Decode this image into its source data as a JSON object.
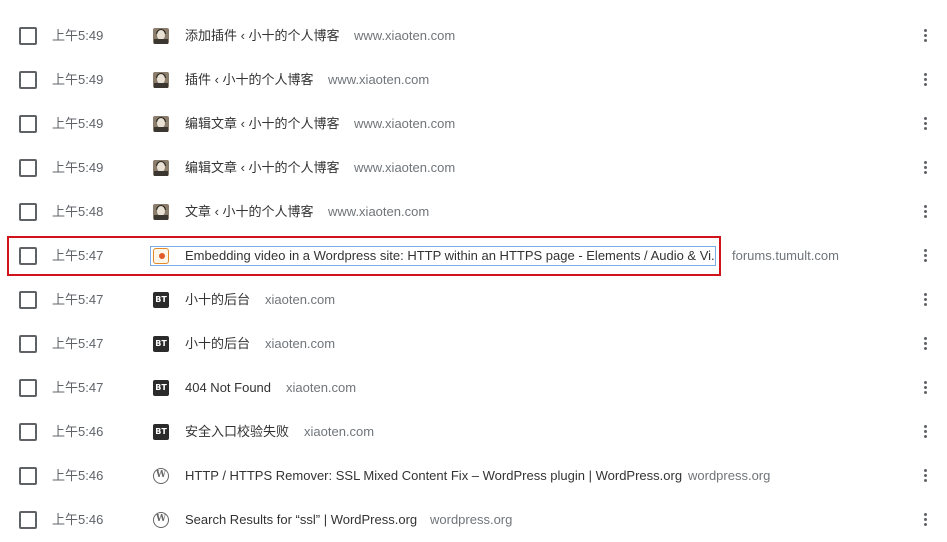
{
  "rows": [
    {
      "time": "上午5:49",
      "favicon": "avatar-photo-icon",
      "title": "添加插件 ‹ 小十的个人博客",
      "domain": "www.xiaoten.com"
    },
    {
      "time": "上午5:49",
      "favicon": "avatar-photo-icon",
      "title": "插件 ‹ 小十的个人博客",
      "domain": "www.xiaoten.com"
    },
    {
      "time": "上午5:49",
      "favicon": "avatar-photo-icon",
      "title": "编辑文章 ‹ 小十的个人博客",
      "domain": "www.xiaoten.com"
    },
    {
      "time": "上午5:49",
      "favicon": "avatar-photo-icon",
      "title": "编辑文章 ‹ 小十的个人博客",
      "domain": "www.xiaoten.com"
    },
    {
      "time": "上午5:48",
      "favicon": "avatar-photo-icon",
      "title": "文章 ‹ 小十的个人博客",
      "domain": "www.xiaoten.com"
    },
    {
      "time": "上午5:47",
      "favicon": "tumult-icon",
      "title": "Embedding video in a Wordpress site: HTTP within an HTTPS page - Elements / Audio & Vi...",
      "domain": "forums.tumult.com"
    },
    {
      "time": "上午5:47",
      "favicon": "bt-panel-icon",
      "favicon_text": "BT",
      "title": "小十的后台",
      "domain": "xiaoten.com"
    },
    {
      "time": "上午5:47",
      "favicon": "bt-panel-icon",
      "favicon_text": "BT",
      "title": "小十的后台",
      "domain": "xiaoten.com"
    },
    {
      "time": "上午5:47",
      "favicon": "bt-panel-icon",
      "favicon_text": "BT",
      "title": "404 Not Found",
      "domain": "xiaoten.com"
    },
    {
      "time": "上午5:46",
      "favicon": "bt-panel-icon",
      "favicon_text": "BT",
      "title": "安全入口校验失败",
      "domain": "xiaoten.com"
    },
    {
      "time": "上午5:46",
      "favicon": "wordpress-icon",
      "favicon_text": "W",
      "title": "HTTP / HTTPS Remover: SSL Mixed Content Fix – WordPress plugin | WordPress.org",
      "domain": "wordpress.org"
    },
    {
      "time": "上午5:46",
      "favicon": "wordpress-icon",
      "favicon_text": "W",
      "title": "Search Results for “ssl” | WordPress.org",
      "domain": "wordpress.org"
    }
  ],
  "colors": {
    "highlight_border": "#d0121b",
    "focus_border": "#7aaee8"
  }
}
